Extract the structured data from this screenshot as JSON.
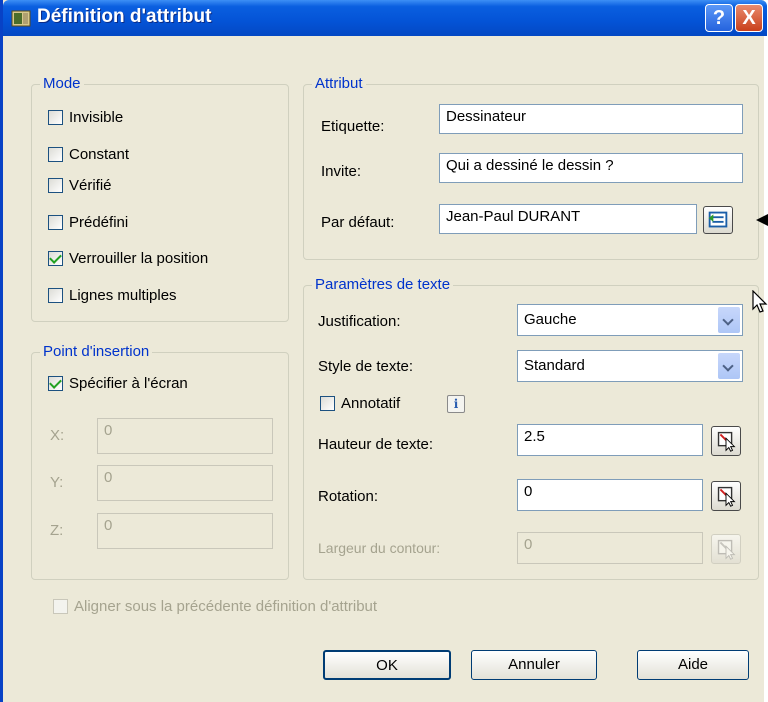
{
  "window": {
    "title": "Définition d'attribut",
    "help_label": "?",
    "close_label": "X"
  },
  "mode": {
    "legend": "Mode",
    "items": [
      {
        "label": "Invisible",
        "checked": false
      },
      {
        "label": "Constant",
        "checked": false
      },
      {
        "label": "Vérifié",
        "checked": false
      },
      {
        "label": "Prédéfini",
        "checked": false
      },
      {
        "label": "Verrouiller la position",
        "checked": true
      },
      {
        "label": "Lignes multiples",
        "checked": false
      }
    ]
  },
  "attribut": {
    "legend": "Attribut",
    "etiquette_label": "Etiquette:",
    "etiquette_value": "Dessinateur",
    "invite_label": "Invite:",
    "invite_value": "Qui a dessiné le dessin ?",
    "defaut_label": "Par défaut:",
    "defaut_value": "Jean-Paul DURANT"
  },
  "insertion": {
    "legend": "Point d'insertion",
    "specify_label": "Spécifier à l'écran",
    "specify_checked": true,
    "x_label": "X:",
    "x_value": "0",
    "y_label": "Y:",
    "y_value": "0",
    "z_label": "Z:",
    "z_value": "0"
  },
  "texte": {
    "legend": "Paramètres de texte",
    "justification_label": "Justification:",
    "justification_value": "Gauche",
    "style_label": "Style de texte:",
    "style_value": "Standard",
    "annotatif_label": "Annotatif",
    "annotatif_checked": false,
    "info_glyph": "i",
    "hauteur_label": "Hauteur de texte:",
    "hauteur_value": "2.5",
    "rotation_label": "Rotation:",
    "rotation_value": "0",
    "largeur_label": "Largeur du contour:",
    "largeur_value": "0"
  },
  "align_label": "Aligner sous la précédente définition d'attribut",
  "buttons": {
    "ok": "OK",
    "cancel": "Annuler",
    "help": "Aide"
  },
  "colors": {
    "title_blue": "#0453d6",
    "legend_blue": "#0033cc",
    "dialog_bg": "#ece9d8"
  }
}
